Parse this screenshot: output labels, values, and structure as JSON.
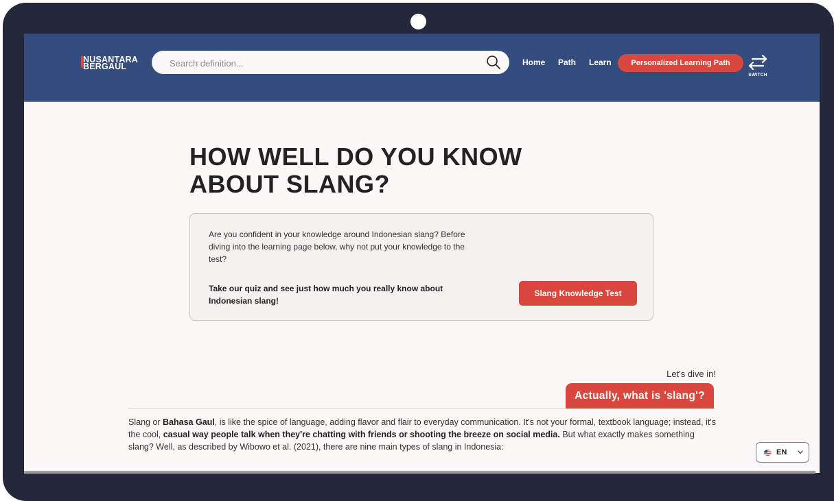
{
  "brand": {
    "line1": "NUSANTARA",
    "line2": "BERGAUL"
  },
  "search": {
    "placeholder": "Search definition...",
    "value": ""
  },
  "nav": {
    "home": "Home",
    "path": "Path",
    "learn": "Learn",
    "cta": "Personalized Learning Path",
    "switch": "SWITCH"
  },
  "hero": {
    "title_line1": "HOW WELL DO YOU KNOW",
    "title_line2": "ABOUT SLANG?"
  },
  "quiz": {
    "intro": "Are you confident in your knowledge around Indonesian slang? Before diving into the learning page below, why not put your knowledge to the test?",
    "cta": "Take our quiz and see just how much you really know about Indonesian slang!",
    "button": "Slang Knowledge Test"
  },
  "section": {
    "kicker": "Let's dive in!",
    "title": "Actually, what is 'slang'?",
    "body": {
      "p1": "Slang or ",
      "b1": "Bahasa Gaul",
      "p2": ", is like the spice of language, adding flavor and flair to everyday communication. It's not your formal, textbook language; instead, it's the cool, ",
      "b2": "casual way people talk when they're chatting with friends or shooting the breeze on social media.",
      "p3": " But what exactly makes something slang? Well, as described by Wibowo et al. (2021), there are nine main types of slang in Indonesia:"
    }
  },
  "language": {
    "selected": "EN",
    "flag_icon": "us-flag-icon"
  },
  "colors": {
    "header": "#344d7e",
    "accent": "#d9473f",
    "page": "#fbf7f6",
    "frame": "#25273a"
  }
}
